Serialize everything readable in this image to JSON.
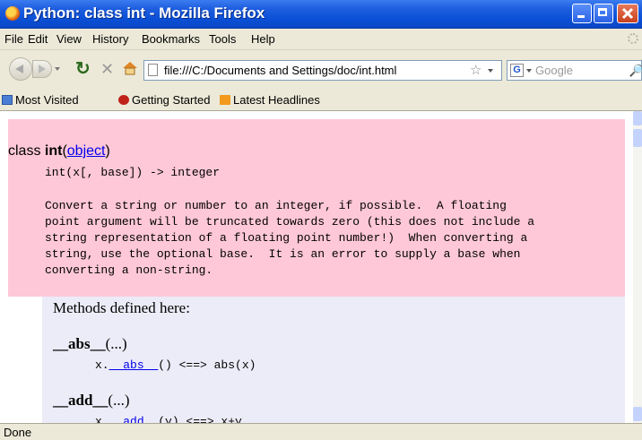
{
  "window": {
    "title": "Python: class int - Mozilla Firefox"
  },
  "menu": [
    "File",
    "Edit",
    "View",
    "History",
    "Bookmarks",
    "Tools",
    "Help"
  ],
  "nav": {
    "url": "file:///C:/Documents and Settings/doc/int.html",
    "search_engine_letter": "G",
    "search_placeholder": "Google"
  },
  "bookmarks": [
    "Most Visited",
    "Getting Started",
    "Latest Headlines"
  ],
  "doc": {
    "class_prefix": "class ",
    "class_name": "int",
    "paren_open": "(",
    "base_link": "object",
    "paren_close": ")",
    "signature": "int(x[, base]) -> integer",
    "description": [
      "Convert a string or number to an integer, if possible.  A floating",
      "point argument will be truncated towards zero (this does not include a",
      "string representation of a floating point number!)  When converting a",
      "string, use the optional base.  It is an error to supply a base when",
      "converting a non-string."
    ],
    "methods_title": "Methods defined here:",
    "methods": [
      {
        "name": "__abs__",
        "args": "(...)",
        "desc_prefix": "x.",
        "desc_link": "__abs__",
        "desc_suffix": "() <==> abs(x)"
      },
      {
        "name": "__add__",
        "args": "(...)",
        "desc_prefix": "x.",
        "desc_link": "__add__",
        "desc_suffix": "(y) <==> x+y"
      }
    ]
  },
  "status": "Done"
}
